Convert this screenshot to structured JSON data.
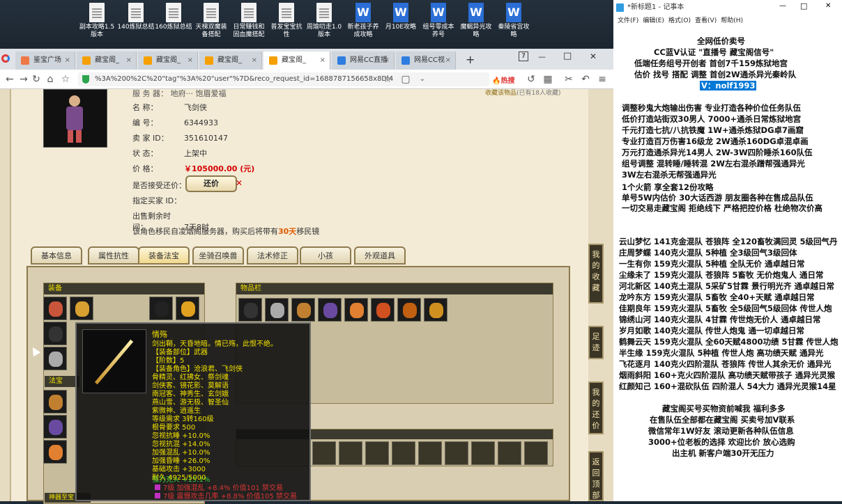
{
  "desktop": {
    "icons": [
      {
        "label": "副本攻略1.5 版本",
        "type": "txt"
      },
      {
        "label": "140炼狱总结",
        "type": "txt"
      },
      {
        "label": "160炼狱总结",
        "type": "txt"
      },
      {
        "label": "天梯双魔装 备搭配",
        "type": "txt"
      },
      {
        "label": "日常赚钱和 固血魔搭配",
        "type": "txt"
      },
      {
        "label": "普发宝宝抗 性",
        "type": "txt"
      },
      {
        "label": "周瑜叨走1.0 版本",
        "type": "txt"
      },
      {
        "label": "新老孩子养 成攻略",
        "type": "word"
      },
      {
        "label": "月10E攻略",
        "type": "word"
      },
      {
        "label": "组号零成本 养号",
        "type": "word"
      },
      {
        "label": "魔蝎异光攻 略",
        "type": "word"
      },
      {
        "label": "秦陵省宫攻 略",
        "type": "word"
      }
    ]
  },
  "browser": {
    "tabs": [
      "鉴宝广场",
      "藏宝阁_",
      "藏宝阁_",
      "藏宝阁_",
      "藏宝阁_",
      "网易CC直播",
      "网易CC视"
    ],
    "new_tab": "+",
    "url": "%3A%200%2C%20\"tag\"%3A%20\"user\"%7D&reco_request_id=1688787156658x8Dl4",
    "hot": "热搜",
    "win_controls": [
      "7",
      "—",
      "□",
      "✕"
    ]
  },
  "item": {
    "server_label": "服 务 器：",
    "server_value": "地府··· 饱眉爱福",
    "name_label": "名      称：",
    "name_value": "飞剑侠",
    "id_label": "编      号：",
    "id_value": "6344933",
    "seller_label": "卖  家  ID：",
    "seller_value": "351610147",
    "status_label": "状      态：",
    "status_value": "上架中",
    "price_label": "价      格：",
    "price_value": "￥105000.00 (元)",
    "bargain_label": "是否接受还价：",
    "bargain_button": "还价",
    "buyer_label": "指定买家 ID：",
    "remain_label": "出售剩余时间：",
    "remain_value": "7天8时",
    "migrate_prefix": "该角色移民自凌烟阁服务器，购买后将带有",
    "migrate_days": "30天",
    "migrate_suffix": "移民镜",
    "collect": "收藏该物品",
    "collect_count": "(已有18人收藏)"
  },
  "detail_tabs": [
    "基本信息",
    "属性抗性",
    "装备法宝",
    "坐骑召唤兽",
    "法术修正",
    "小孩",
    "外观道具"
  ],
  "panels": {
    "equip": "装备",
    "fabao": "法宝",
    "inventory": "物品栏",
    "more": "神器至宝"
  },
  "side_buttons": [
    "我的收藏",
    "足迹",
    "我的还价",
    "返回顶部"
  ],
  "tooltip": {
    "name": "情殇",
    "lines": [
      "剑出鞘，天昏地暗。情已殇，此恨不绝。",
      "【装备部位】武器",
      "【阶数】5",
      "【装备角色】沧浪君、飞剑侠",
      "骨精灵、红拂女、祭剑魂",
      "剑侠客、镜花影、莫解语",
      "南冠客、神秀生、玄剑娥",
      "燕山雪、游无极、智圣仙",
      "紫微神、逍遥生",
      "等级需求 3转160级",
      "根骨要求 500",
      "忽视抗睡 +10.0%",
      "忽视抗混 +14.0%",
      "加强混乱 +10.0%",
      "加强昏睡 +26.0%",
      "基础攻击 +3000",
      "耐久 4925/5000"
    ],
    "bonus": "强力克火 +15.1%",
    "gems": [
      "7级 加强混乱 +8.4% 价值101 禁交易",
      "7级 震慑攻击几率 +8.8% 价值105 禁交易"
    ]
  },
  "notepad": {
    "title": "*新标题1 - 记事本",
    "menu": [
      "文件(F)",
      "编辑(E)",
      "格式(O)",
      "查看(V)",
      "帮助(H)"
    ],
    "controls": [
      "—",
      "□",
      "✕"
    ],
    "header": [
      "全网低价卖号",
      "CC蓝V认证 \"直播号 藏宝阁信号\"",
      "低端任务组号开创者          首创7千159炼狱地宫",
      "估价 找号 搭配 调整           首创2W通杀异光秦岭队"
    ],
    "contact": "V：nolf1993",
    "block1": [
      "调整秒鬼大炮输出伤害         专业打造各种价位任务队伍",
      "低价打造站街双30男人           7000+通杀日常炼狱地宫",
      "千元打造七抗/八抗铁魔          1W+通杀炼狱DG卓7画窟",
      "专业打造百万伤害16级龙          2W通杀160DG卓混卓画",
      "万元打造通杀异光14男人        2W-3W四阶睡杀160队伍",
      "组号调整 混转睡/睡转混            2W左右混杀蹭帮强通异光",
      "                                              3W左右混杀无帮强通异光"
    ],
    "block2": [
      "1个火箭 享全套12份攻略",
      "单号5W内估价 30大话西游      朋友圈各种在售成品队伍",
      "一切交易走藏宝阁 拒绝线下     严格把控价格 杜绝物次价高"
    ],
    "block3": [
      "云山梦忆 141克金混队 苍狼阵 全120畜牧满回灵 5级回气丹",
      "庄周梦蝶 140克火混队 5种植 全3级回气3级回体",
      "一生有你 159克火混队 5种植 全队无价 通卓越日常",
      "尘缘未了 159克火混队 苍狼阵 5畜牧 无价炮鬼人 通日常",
      "河北新区 140克土混队 5采矿5甘霖 景行明光齐 通卓越日常",
      "龙吟东方 159克火混队 5畜牧 全40+天赋 通卓越日常",
      "佳期良年 159克火混队 5畜牧 全5级回气5级回体 传世人炮",
      "锦绣山河 140克火混队 4甘霖 传世炮无价人 通卓越日常",
      "岁月如歌 140克火混队 传世人炮鬼 通一切卓越日常",
      "鹤舞云天 159克火混队 全60天赋4800功绩 5甘霖 传世人炮",
      "半生缘    159克火混队 5种植 传世人炮 高功绩天赋 通异光",
      "飞花逐月 140克火四阶混队 苍狼阵 传世人其余无价 通异光",
      "烟雨斜阳 160+克火四阶混队 高功绩天赋带孩子 通异光灵猴",
      "红颜知己 160+混砍队伍 四阶混人 54大力 通异光灵猴14星"
    ],
    "block4": [
      "藏宝阁买号买物资前喊我 福利多多",
      "在售队伍全部都在藏宝阁 买卖号加V联系",
      "微信常年1W好友 滚动更新各种队伍信息",
      "3000+位老板的选择 欢迎比价 放心选购",
      "出主机 新客户端30开无压力"
    ]
  },
  "colors": {
    "accent": "#2b6fd6",
    "price": "#d40000",
    "gold": "#f2e100",
    "green": "#3bd13b"
  }
}
